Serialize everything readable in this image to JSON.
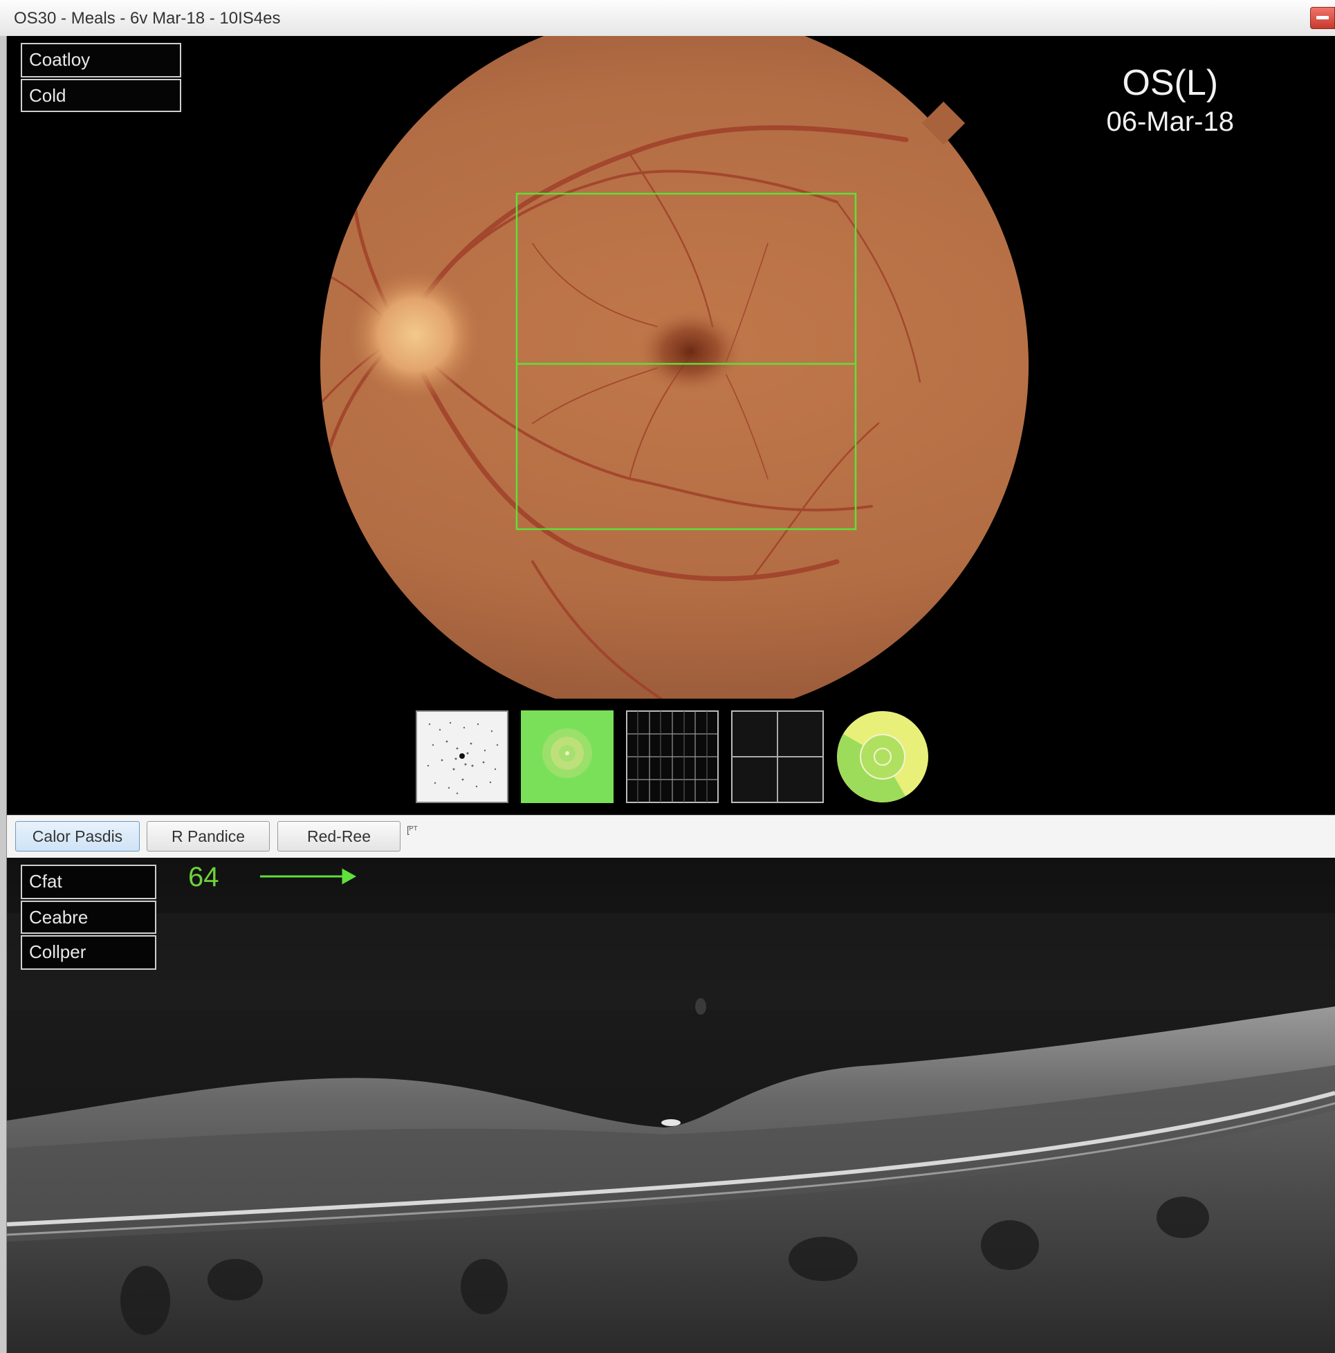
{
  "window": {
    "title": "OS30 - Meals - 6v Mar-18 - 10IS4es"
  },
  "fundus_panel": {
    "buttons": [
      "Coatloy",
      "Cold"
    ],
    "eye": "OS(L)",
    "date": "06-Mar-18",
    "overlay_color": "#5fe03a",
    "thumbnails": [
      {
        "name": "density-map-thumbnail",
        "kind": "dot-density"
      },
      {
        "name": "green-field-thumbnail",
        "kind": "green-field"
      },
      {
        "name": "fine-grid-thumbnail",
        "kind": "grid-4x4"
      },
      {
        "name": "quad-grid-thumbnail",
        "kind": "grid-2x2"
      },
      {
        "name": "sector-map-thumbnail",
        "kind": "sector-circle"
      }
    ]
  },
  "tabs": {
    "items": [
      "Calor Pasdis",
      "R Pandice",
      "Red-Ree"
    ],
    "active_index": 0,
    "extra": "[ᴾᵀ"
  },
  "oct_panel": {
    "buttons": [
      "Cfat",
      "Ceabre",
      "Collper"
    ],
    "value": "64",
    "arrow_color": "#5fe03a"
  }
}
